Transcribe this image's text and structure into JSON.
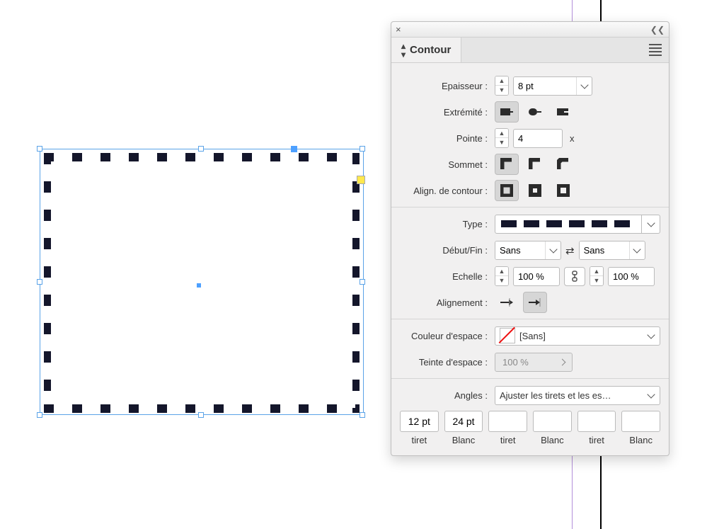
{
  "panel": {
    "title": "Contour",
    "weight_label": "Epaisseur :",
    "weight_value": "8 pt",
    "cap_label": "Extrémité :",
    "miter_label": "Pointe :",
    "miter_value": "4",
    "miter_x": "x",
    "join_label": "Sommet :",
    "align_label": "Align. de contour :",
    "type_label": "Type :",
    "startend_label": "Début/Fin :",
    "start_value": "Sans",
    "end_value": "Sans",
    "scale_label": "Echelle :",
    "scale_start": "100 %",
    "scale_end": "100 %",
    "arrow_align_label": "Alignement :",
    "gap_color_label": "Couleur d'espace :",
    "gap_color_value": "[Sans]",
    "gap_tint_label": "Teinte d'espace :",
    "gap_tint_value": "100 %",
    "corners_label": "Angles :",
    "corners_value": "Ajuster les tirets et les es…",
    "dash_values": [
      "12 pt",
      "24 pt",
      "",
      "",
      "",
      ""
    ],
    "dash_labels": [
      "tiret",
      "Blanc",
      "tiret",
      "Blanc",
      "tiret",
      "Blanc"
    ]
  },
  "stroke_preview": {
    "dash": 12,
    "gap": 24,
    "weight": 8
  }
}
